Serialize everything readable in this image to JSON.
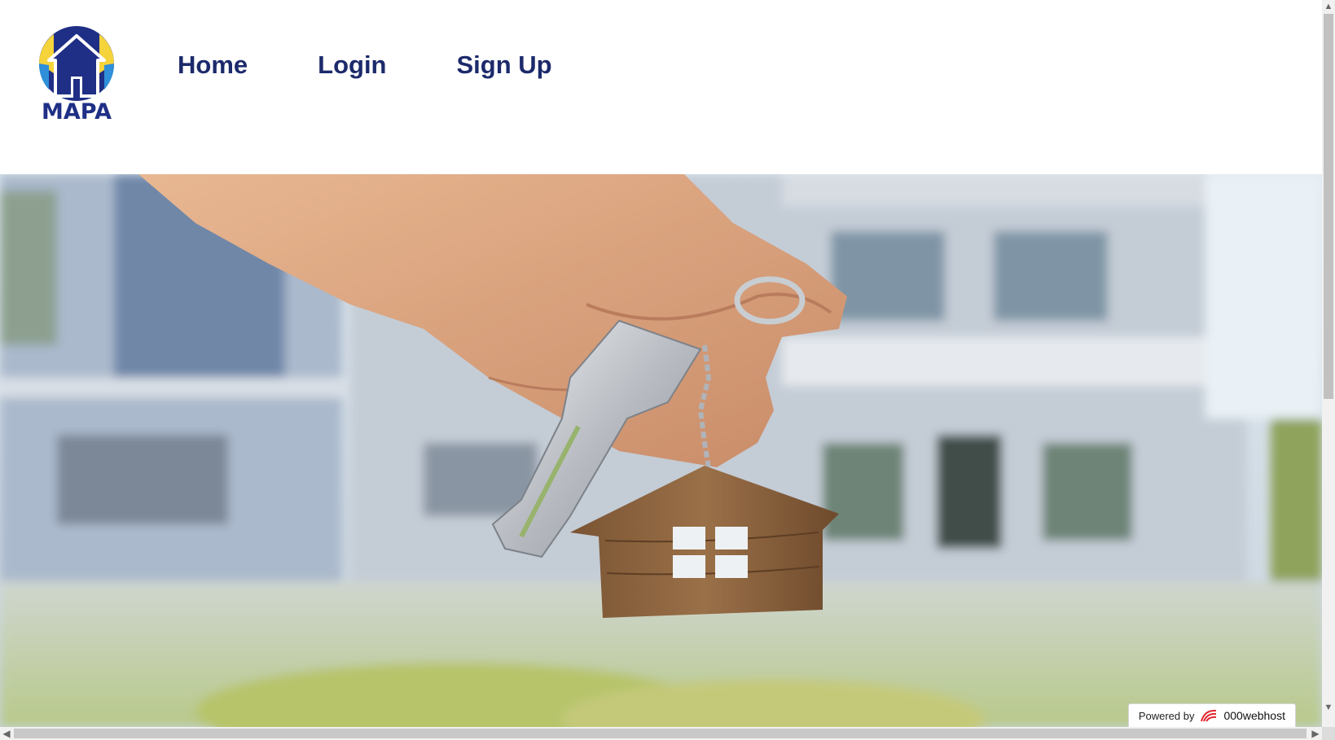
{
  "logo": {
    "text": "MAPA",
    "colors": {
      "navy": "#1f2f86",
      "yellow": "#f5d33b",
      "sky": "#2f8fd8"
    }
  },
  "nav": {
    "items": [
      {
        "label": "Home"
      },
      {
        "label": "Login"
      },
      {
        "label": "Sign Up"
      }
    ]
  },
  "hero": {
    "image": "hand-holding-house-keys-photo"
  },
  "footer_badge": {
    "prefix": "Powered by",
    "brand": "000webhost",
    "icon": "000webhost-logo-icon"
  },
  "colors": {
    "nav_text": "#1c2a6b"
  }
}
